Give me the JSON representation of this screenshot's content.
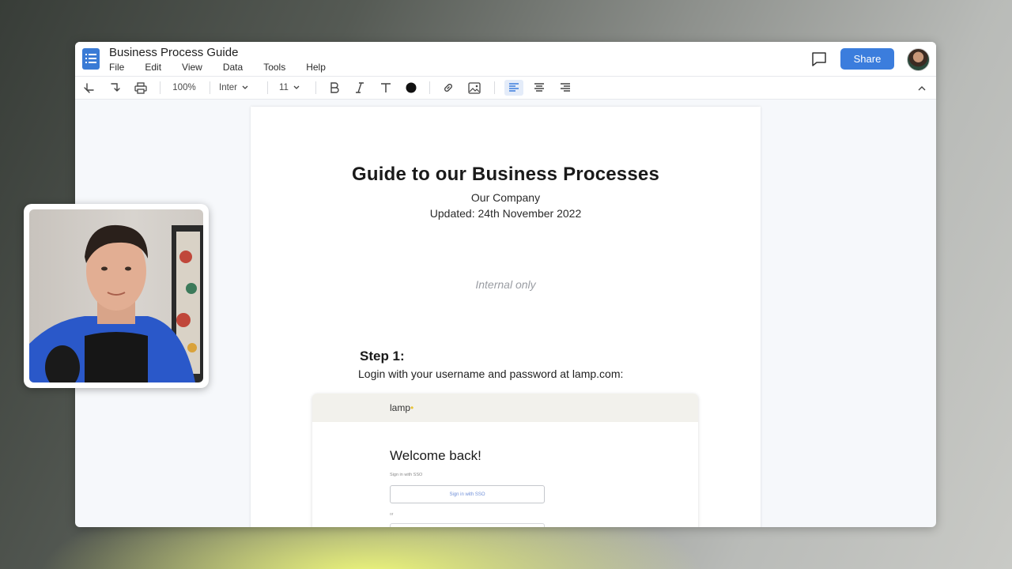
{
  "app": {
    "doc_title": "Business Process Guide",
    "menu": [
      "File",
      "Edit",
      "View",
      "Data",
      "Tools",
      "Help"
    ],
    "share_label": "Share"
  },
  "toolbar": {
    "zoom": "100%",
    "font": "Inter",
    "font_size": "11"
  },
  "document": {
    "title": "Guide to our Business Processes",
    "company": "Our Company",
    "updated": "Updated: 24th November 2022",
    "note": "Internal only",
    "step_heading": "Step 1:",
    "step_text": "Login with your username and password at lamp.com:"
  },
  "embedded_screenshot": {
    "logo_text": "lamp",
    "welcome": "Welcome back!",
    "sso_label": "Sign in with SSO",
    "sso_button": "Sign in with SSO",
    "or_label": "or"
  },
  "colors": {
    "accent": "#3b7ddd",
    "page_bg": "#f6f8fb"
  }
}
